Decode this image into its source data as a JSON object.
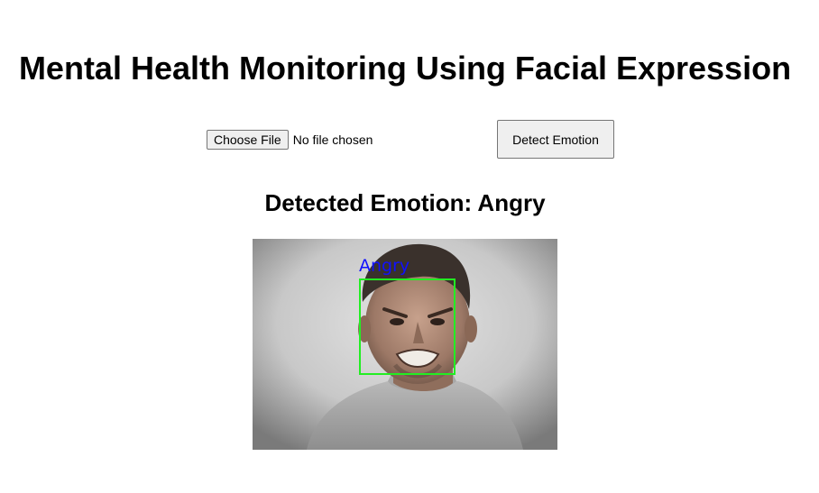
{
  "page": {
    "title": "Mental Health Monitoring Using Facial Expression"
  },
  "upload": {
    "choose_button_label": "Choose File",
    "file_status": "No file chosen"
  },
  "actions": {
    "detect_label": "Detect Emotion"
  },
  "result": {
    "heading": "Detected Emotion: Angry",
    "face_label": "Angry",
    "face_label_color": "#1010ff",
    "face_box_color": "#22ee22"
  }
}
